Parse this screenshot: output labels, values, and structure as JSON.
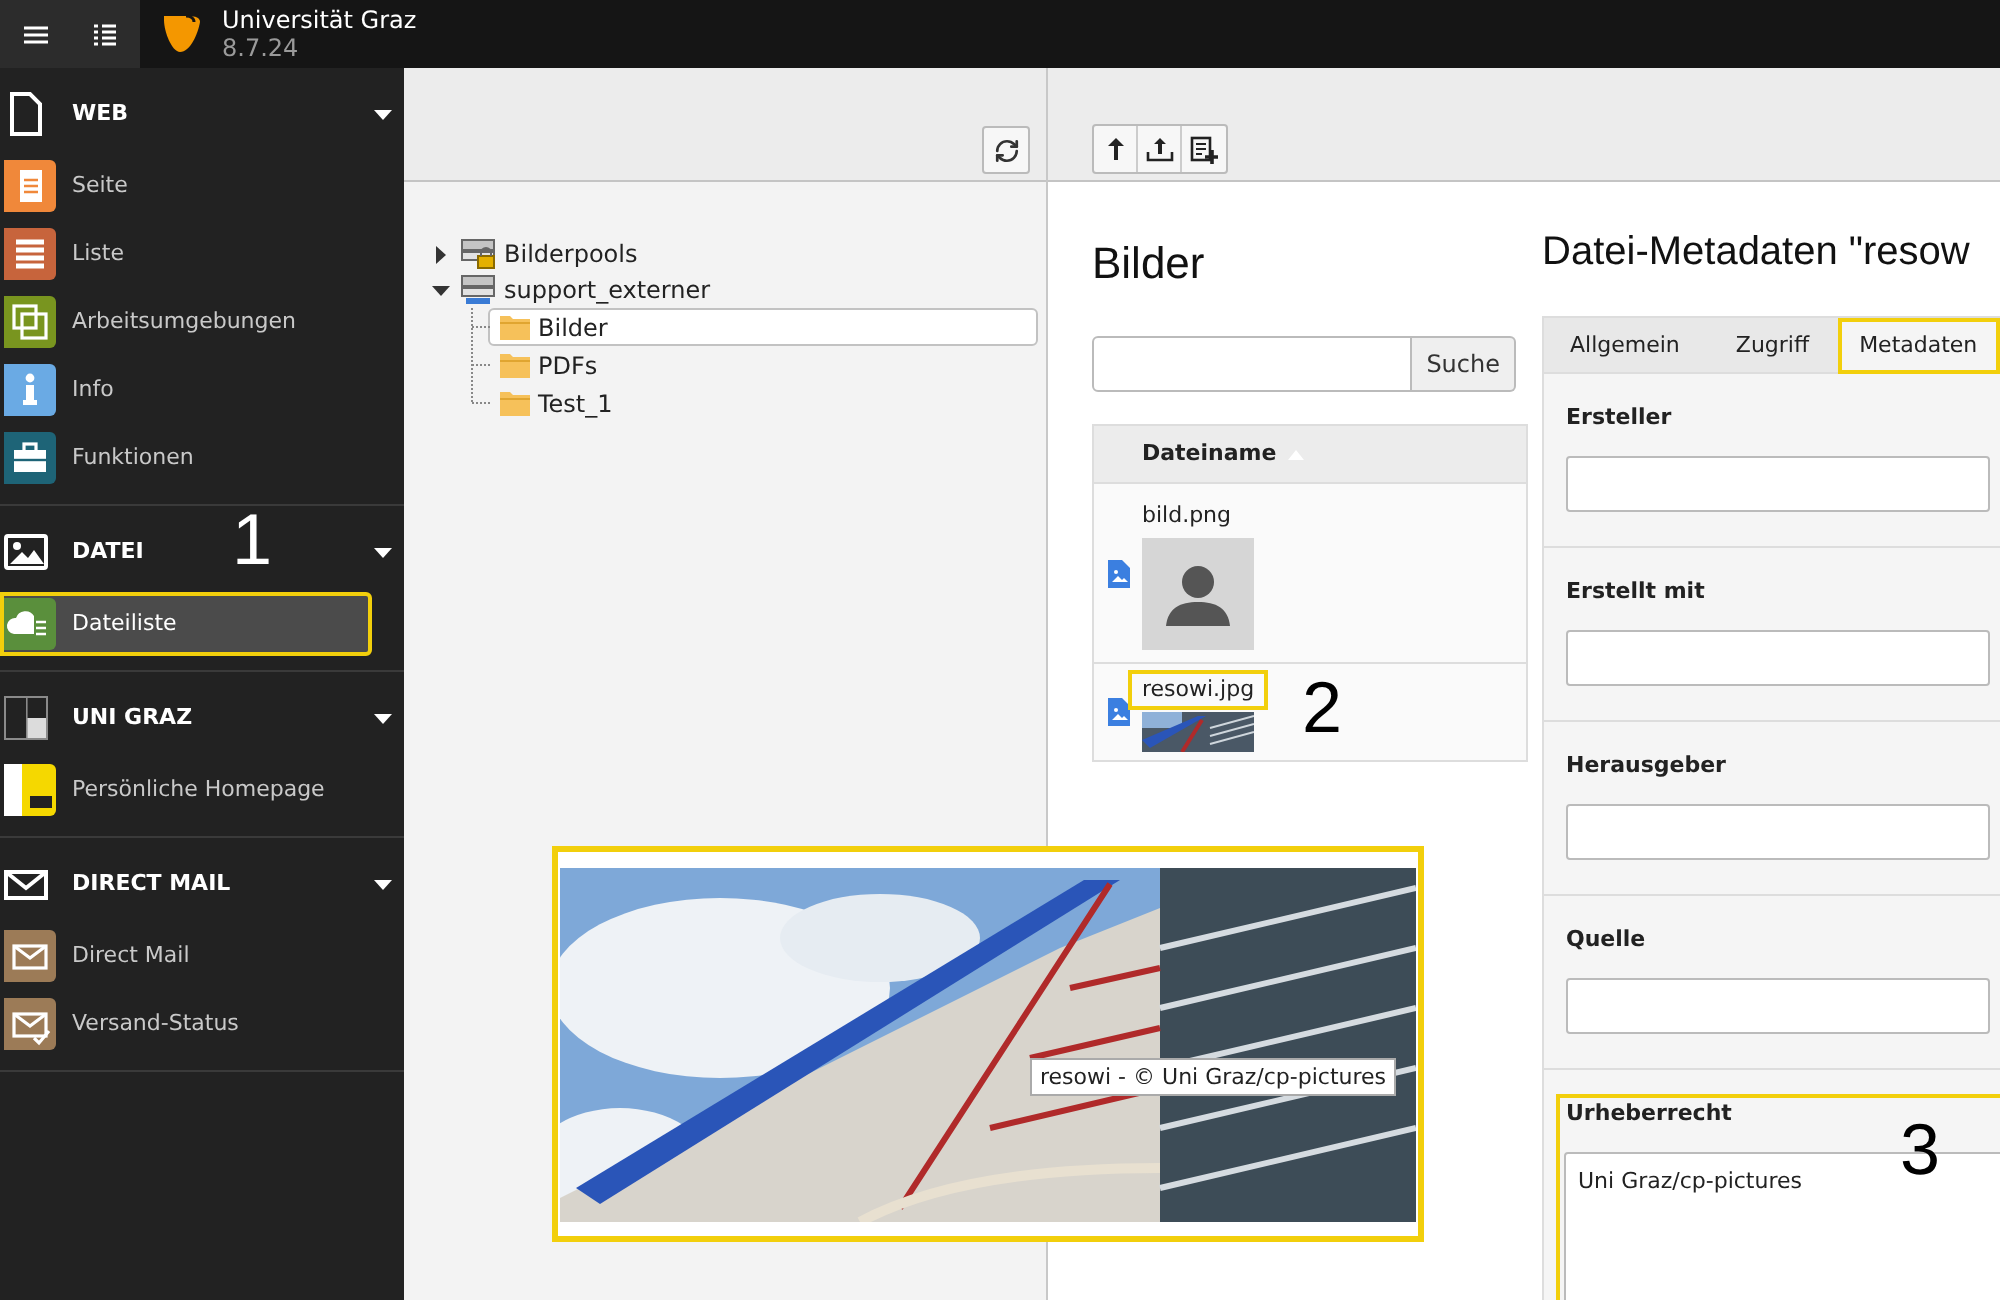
{
  "topbar": {
    "title": "Universität Graz",
    "version": "8.7.24"
  },
  "sidebar": {
    "groups": [
      {
        "label": "WEB",
        "expanded": true,
        "items": [
          {
            "label": "Seite",
            "color": "#f0883a",
            "selected": false,
            "highlighted": false
          },
          {
            "label": "Liste",
            "color": "#c7643c",
            "selected": false,
            "highlighted": false
          },
          {
            "label": "Arbeitsumgebungen",
            "color": "#79951f",
            "selected": false,
            "highlighted": false
          },
          {
            "label": "Info",
            "color": "#6aaae4",
            "selected": false,
            "highlighted": false
          },
          {
            "label": "Funktionen",
            "color": "#1e6477",
            "selected": false,
            "highlighted": false
          }
        ]
      },
      {
        "label": "DATEI",
        "expanded": true,
        "callout": "1",
        "items": [
          {
            "label": "Dateiliste",
            "color": "#5a8f3c",
            "selected": true,
            "highlighted": true
          }
        ]
      },
      {
        "label": "UNI GRAZ",
        "expanded": true,
        "items": [
          {
            "label": "Persönliche Homepage",
            "color": "#f5d800",
            "selected": false,
            "highlighted": false
          }
        ]
      },
      {
        "label": "DIRECT MAIL",
        "expanded": true,
        "items": [
          {
            "label": "Direct Mail",
            "color": "#9c7b57",
            "selected": false,
            "highlighted": false
          },
          {
            "label": "Versand-Status",
            "color": "#9c7b57",
            "selected": false,
            "highlighted": false
          }
        ]
      }
    ]
  },
  "folder_tree": {
    "nodes": [
      {
        "label": "Bilderpools",
        "expanded": false,
        "selected": false
      },
      {
        "label": "support_externer",
        "expanded": true,
        "selected": false,
        "children": [
          {
            "label": "Bilder",
            "selected": true
          },
          {
            "label": "PDFs",
            "selected": false
          },
          {
            "label": "Test_1",
            "selected": false
          }
        ]
      }
    ]
  },
  "file_list": {
    "title": "Bilder",
    "search": {
      "button": "Suche"
    },
    "column": {
      "label": "Dateiname",
      "sort_ascending": true
    },
    "rows": [
      {
        "name": "bild.png",
        "kind": "silhouette",
        "highlighted": false
      },
      {
        "name": "resowi.jpg",
        "kind": "photo",
        "highlighted": true,
        "callout": "2"
      }
    ]
  },
  "metadata": {
    "title": "Datei-Metadaten \"resow",
    "tabs": [
      {
        "label": "Allgemein",
        "selected": false,
        "highlighted": false
      },
      {
        "label": "Zugriff",
        "selected": false,
        "highlighted": false
      },
      {
        "label": "Metadaten",
        "selected": true,
        "highlighted": true
      }
    ],
    "fields": [
      {
        "label": "Ersteller",
        "kind": "input",
        "highlighted": false
      },
      {
        "label": "Erstellt mit",
        "kind": "input",
        "highlighted": false
      },
      {
        "label": "Herausgeber",
        "kind": "input",
        "highlighted": false
      },
      {
        "label": "Quelle",
        "kind": "input",
        "highlighted": false
      },
      {
        "label": "Urheberrecht",
        "kind": "textarea",
        "value": "Uni Graz/cp-pictures",
        "highlighted": true,
        "callout": "3"
      }
    ]
  },
  "preview": {
    "caption": "resowi - © Uni Graz/cp-pictures",
    "highlighted": true
  }
}
